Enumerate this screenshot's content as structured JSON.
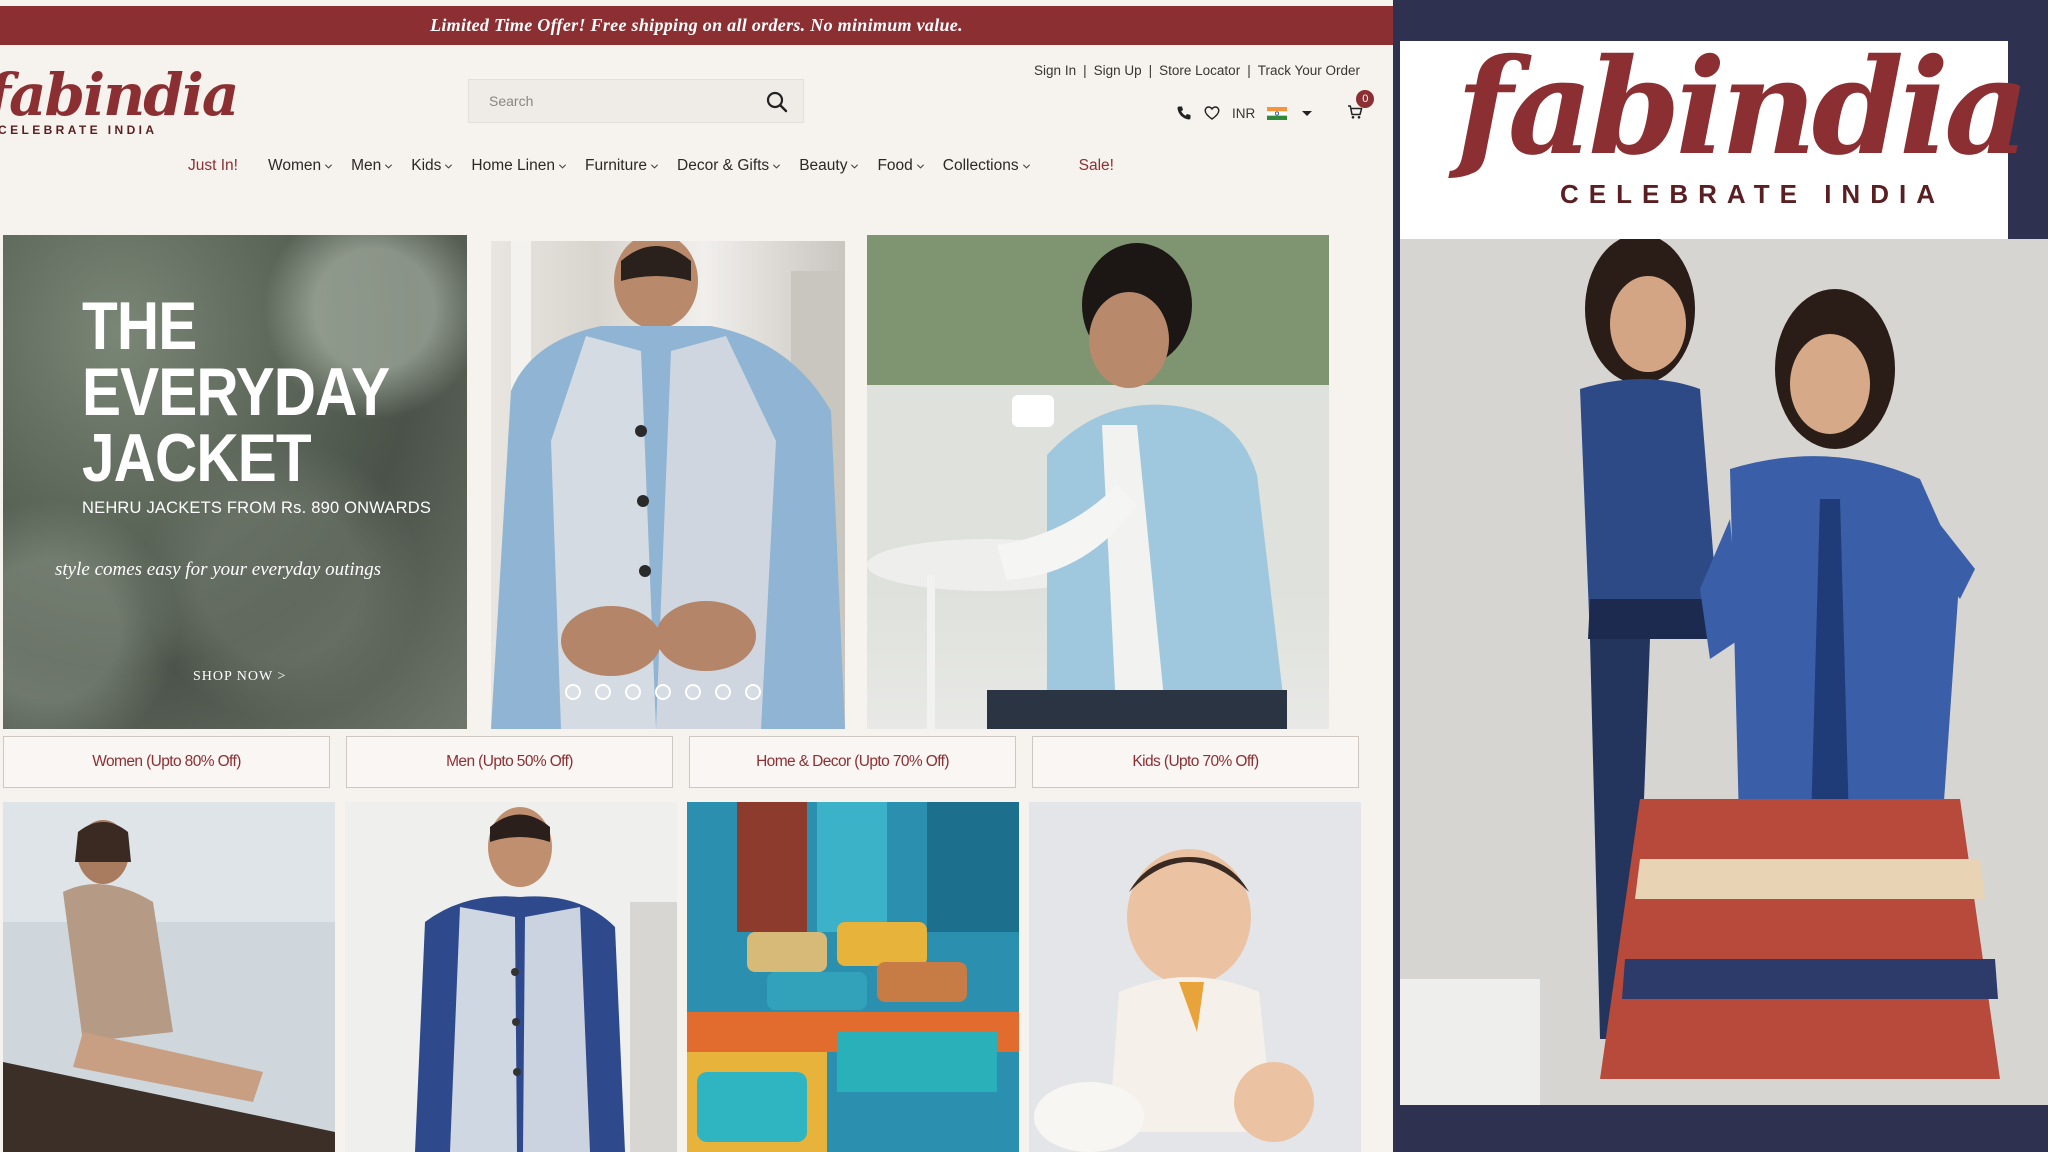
{
  "promo": {
    "text": "Limited Time Offer! Free shipping on all orders. No minimum value."
  },
  "brand": {
    "wordmark": "fabindia",
    "tagline": "CELEBRATE INDIA"
  },
  "search": {
    "placeholder": "Search"
  },
  "account_links": [
    "Sign In",
    "Sign Up",
    "Store Locator",
    "Track Your Order"
  ],
  "utility": {
    "currency": "INR",
    "cart_count": "0"
  },
  "nav": {
    "just_in": "Just In!",
    "items": [
      "Women",
      "Men",
      "Kids",
      "Home Linen",
      "Furniture",
      "Decor & Gifts",
      "Beauty",
      "Food",
      "Collections"
    ],
    "sale": "Sale!"
  },
  "hero": {
    "title_line1": "THE",
    "title_line2": "EVERYDAY",
    "title_line3": "JACKET",
    "subtitle": "NEHRU JACKETS FROM Rs. 890 ONWARDS",
    "tagline": "style comes easy for your everyday outings",
    "cta": "SHOP NOW >",
    "slide_count": 7
  },
  "category_tabs": [
    "Women (Upto 80% Off)",
    "Men (Upto 50% Off)",
    "Home & Decor (Upto 70% Off)",
    "Kids (Upto 70% Off)"
  ],
  "colors": {
    "brand_maroon": "#8c2f33",
    "page_bg": "#f6f2ee",
    "navy_frame": "#2f3151"
  }
}
